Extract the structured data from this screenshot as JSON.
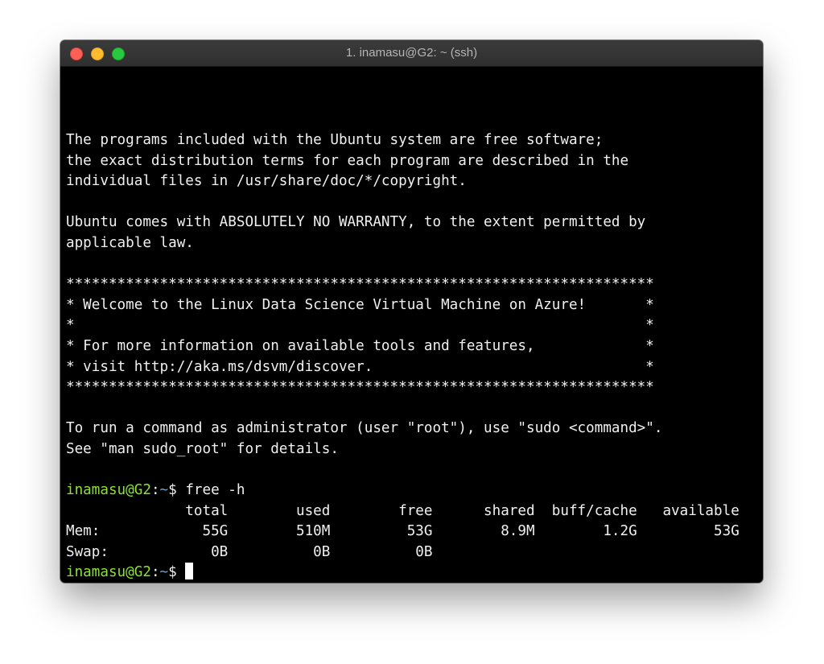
{
  "window": {
    "title": "1. inamasu@G2: ~ (ssh)",
    "colors": {
      "close": "#fe5f57",
      "minimize": "#febc2e",
      "maximize": "#28c840",
      "background": "#000000",
      "text": "#f0f0f0",
      "prompt_user": "#8ae234",
      "prompt_path": "#729fcf"
    }
  },
  "terminal": {
    "lines": [
      "The programs included with the Ubuntu system are free software;",
      "the exact distribution terms for each program are described in the",
      "individual files in /usr/share/doc/*/copyright.",
      "",
      "Ubuntu comes with ABSOLUTELY NO WARRANTY, to the extent permitted by",
      "applicable law.",
      "",
      "*********************************************************************",
      "* Welcome to the Linux Data Science Virtual Machine on Azure!       *",
      "*                                                                   *",
      "* For more information on available tools and features,             *",
      "* visit http://aka.ms/dsvm/discover.                                *",
      "*********************************************************************",
      "",
      "To run a command as administrator (user \"root\"), use \"sudo <command>\".",
      "See \"man sudo_root\" for details.",
      ""
    ],
    "command_prompt": {
      "user_host": "inamasu@G2",
      "separator": ":",
      "path": "~",
      "symbol": "$ ",
      "command": "free -h"
    },
    "free_output": [
      "              total        used        free      shared  buff/cache   available",
      "Mem:            55G        510M         53G        8.9M        1.2G         53G",
      "Swap:            0B          0B          0B"
    ],
    "final_prompt": {
      "user_host": "inamasu@G2",
      "separator": ":",
      "path": "~",
      "symbol": "$ "
    }
  }
}
